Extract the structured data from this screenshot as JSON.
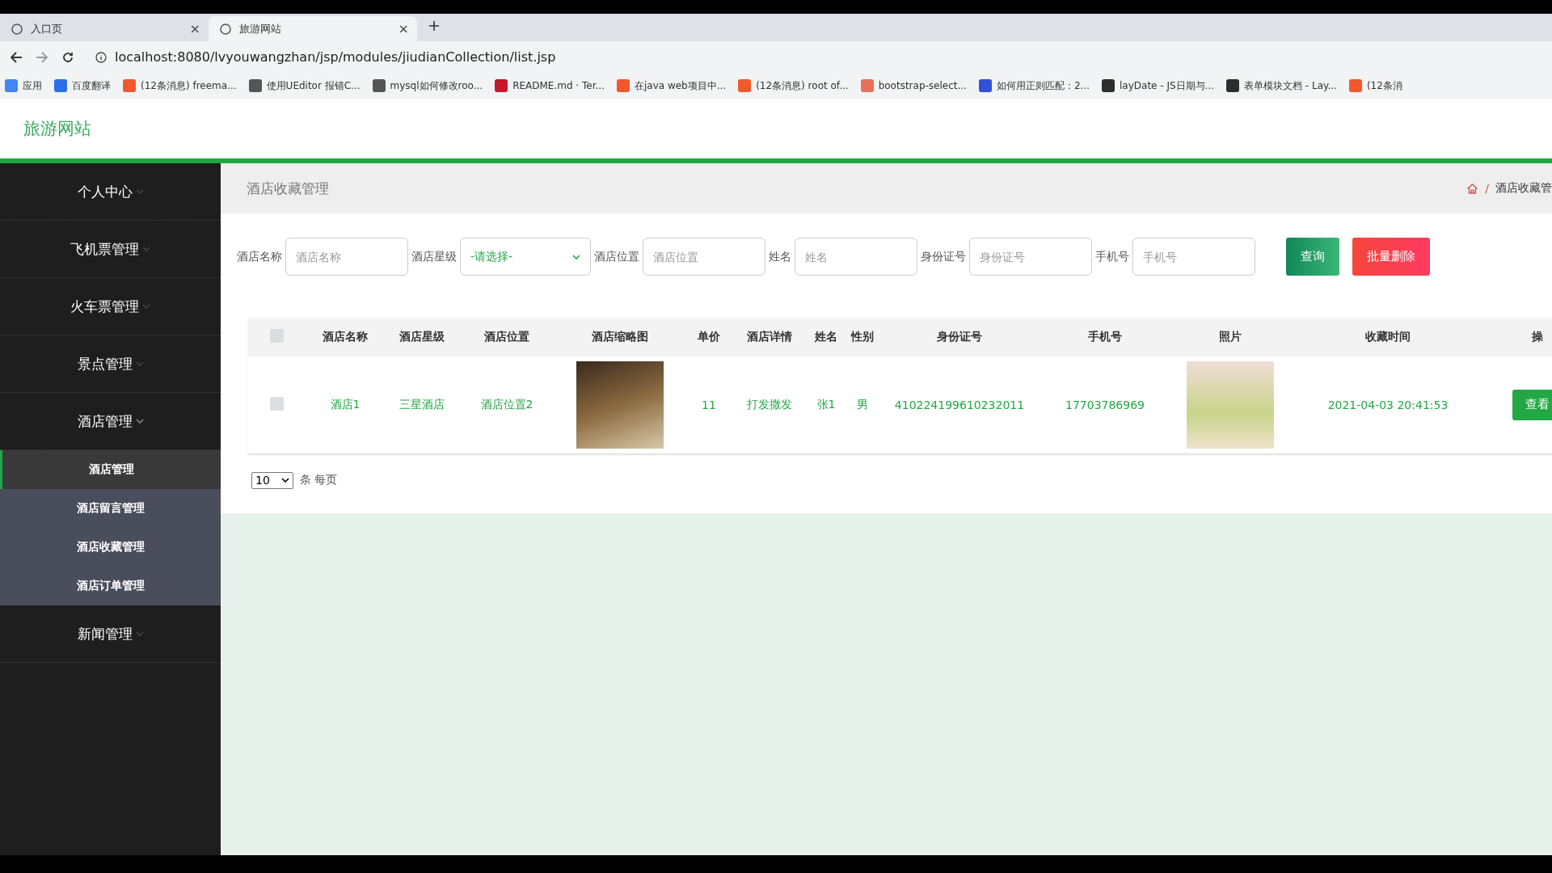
{
  "browser": {
    "tabs": [
      {
        "title": "入口页",
        "close": "×",
        "selected": false
      },
      {
        "title": "旅游网站",
        "close": "×",
        "selected": true
      }
    ],
    "address": "localhost:8080/lvyouwangzhan/jsp/modules/jiudianCollection/list.jsp",
    "bookmarks": [
      {
        "label": "应用",
        "kind": "apps"
      },
      {
        "label": "百度翻译",
        "kind": "translate"
      },
      {
        "label": "(12条消息) freema...",
        "kind": "c"
      },
      {
        "label": "使用UEditor 报错C...",
        "kind": "bird"
      },
      {
        "label": "mysql如何修改roo...",
        "kind": "bird"
      },
      {
        "label": "README.md · Ter...",
        "kind": "g"
      },
      {
        "label": "在java web项目中...",
        "kind": "c"
      },
      {
        "label": "(12条消息) root of...",
        "kind": "c"
      },
      {
        "label": "bootstrap-select...",
        "kind": "jian"
      },
      {
        "label": "如何用正则匹配：2...",
        "kind": "paw"
      },
      {
        "label": "layDate - JS日期与...",
        "kind": "lay"
      },
      {
        "label": "表单模块文档 - Lay...",
        "kind": "lay"
      },
      {
        "label": "(12条消",
        "kind": "c"
      }
    ]
  },
  "header": {
    "logo": "旅游网站"
  },
  "sidebar": {
    "items": [
      {
        "label": "个人中心",
        "expanded": false
      },
      {
        "label": "飞机票管理",
        "expanded": false
      },
      {
        "label": "火车票管理",
        "expanded": false
      },
      {
        "label": "景点管理",
        "expanded": false
      },
      {
        "label": "酒店管理",
        "expanded": true,
        "children": [
          {
            "label": "酒店管理",
            "selected": true
          },
          {
            "label": "酒店留言管理",
            "selected": false
          },
          {
            "label": "酒店收藏管理",
            "selected": false
          },
          {
            "label": "酒店订单管理",
            "selected": false
          }
        ]
      },
      {
        "label": "新闻管理",
        "expanded": false
      }
    ]
  },
  "page": {
    "title": "酒店收藏管理",
    "breadcrumb_separator": "/",
    "breadcrumb": "酒店收藏管"
  },
  "search": {
    "fields": [
      {
        "label": "酒店名称",
        "placeholder": "酒店名称",
        "kind": "input"
      },
      {
        "label": "酒店星级",
        "value": "-请选择-",
        "kind": "select"
      },
      {
        "label": "酒店位置",
        "placeholder": "酒店位置",
        "kind": "input"
      },
      {
        "label": "姓名",
        "placeholder": "姓名",
        "kind": "input"
      },
      {
        "label": "身份证号",
        "placeholder": "身份证号",
        "kind": "input"
      },
      {
        "label": "手机号",
        "placeholder": "手机号",
        "kind": "input"
      }
    ],
    "buttons": [
      {
        "label": "查询",
        "kind": "search"
      },
      {
        "label": "批量删除",
        "kind": "delete"
      }
    ]
  },
  "table": {
    "columns": [
      "酒店名称",
      "酒店星级",
      "酒店位置",
      "酒店缩略图",
      "单价",
      "酒店详情",
      "姓名",
      "性别",
      "身份证号",
      "手机号",
      "照片",
      "收藏时间",
      "操"
    ],
    "all_checked": false,
    "rows": [
      {
        "checked": false,
        "cells": [
          "酒店1",
          "三星酒店",
          "酒店位置2",
          {
            "kind": "photo"
          },
          "11",
          "打发撒发",
          "张1",
          "男",
          "410224199610232011",
          "17703786969",
          {
            "kind": "photo"
          },
          "2021-04-03 20:41:53",
          {
            "kind": "button",
            "label": "查看"
          }
        ]
      }
    ]
  },
  "pagination": {
    "page_size": "10",
    "suffix": "条 每页"
  }
}
